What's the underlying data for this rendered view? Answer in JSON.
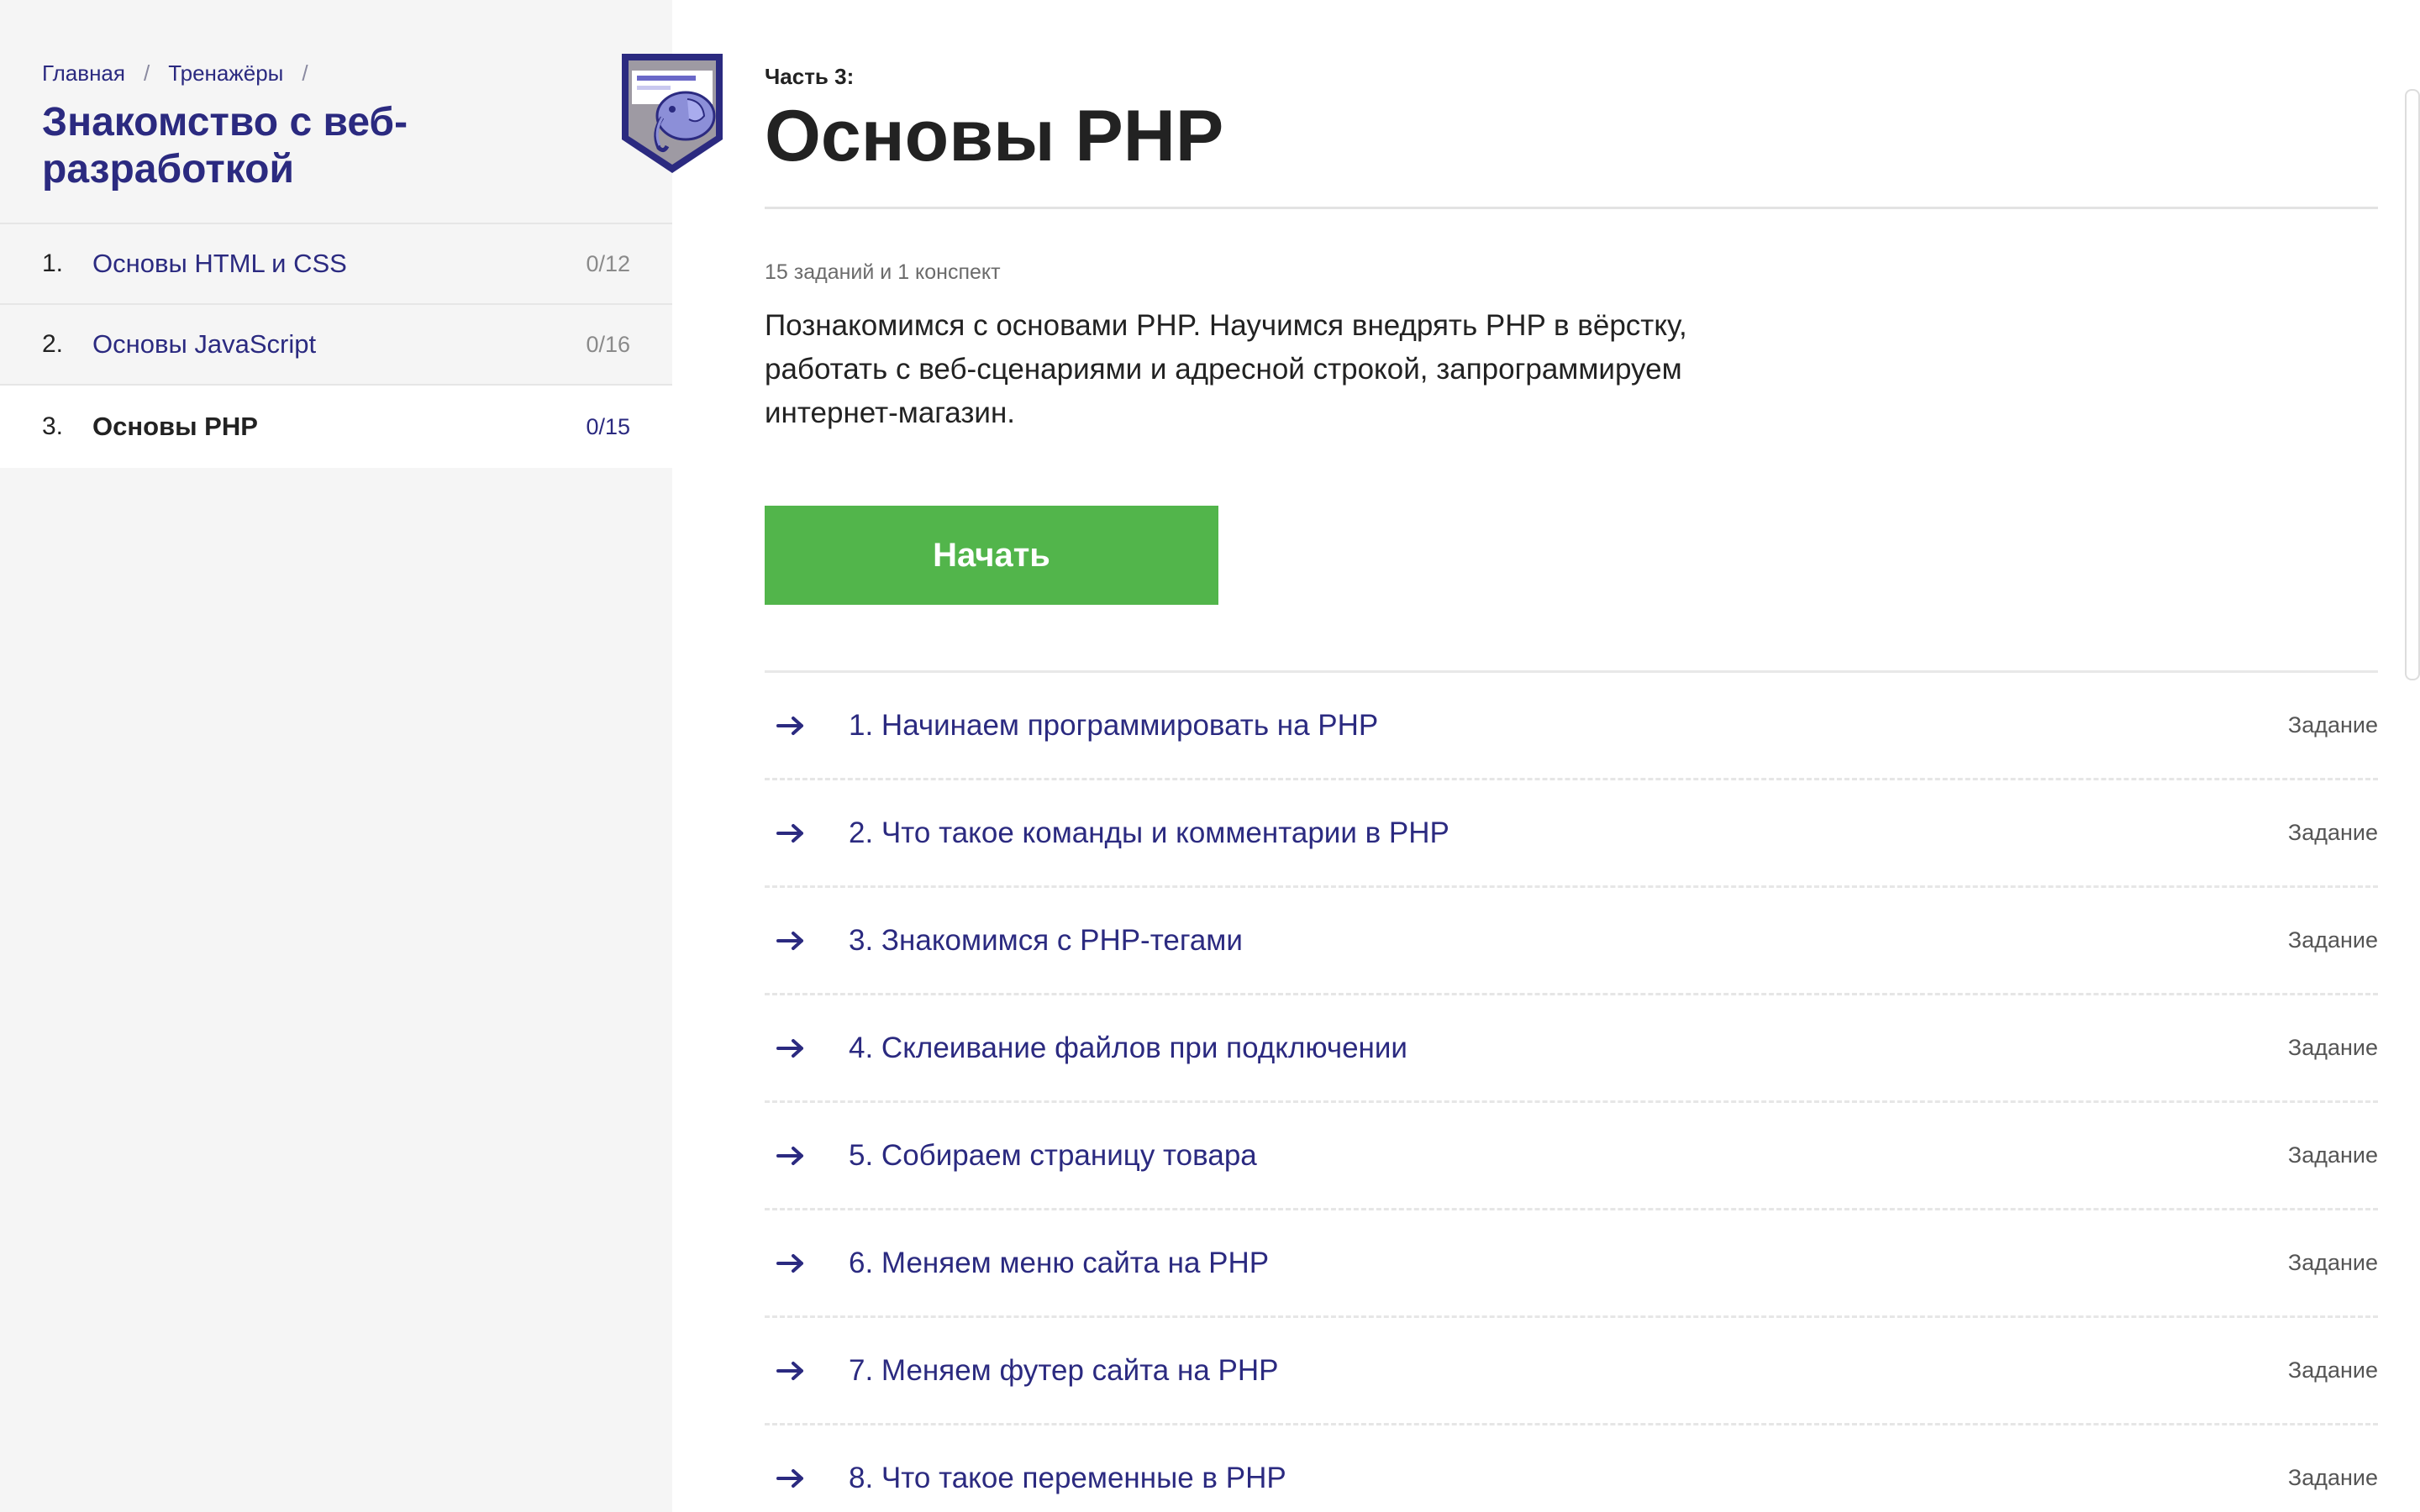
{
  "breadcrumb": {
    "items": [
      "Главная",
      "Тренажёры"
    ],
    "separator": "/"
  },
  "course": {
    "title": "Знакомство с веб-разработкой",
    "badge_icon": "php-elephant-shield-icon"
  },
  "parts": [
    {
      "num": "1.",
      "label": "Основы HTML и CSS",
      "count": "0/12",
      "active": false
    },
    {
      "num": "2.",
      "label": "Основы JavaScript",
      "count": "0/16",
      "active": false
    },
    {
      "num": "3.",
      "label": "Основы PHP",
      "count": "0/15",
      "active": true
    }
  ],
  "main": {
    "part_label": "Часть 3:",
    "title": "Основы PHP",
    "meta": "15 заданий и 1 конспект",
    "description": "Познакомимся с основами PHP. Научимся внедрять PHP в вёрстку, работать с веб-сценариями и адресной строкой, запрограммируем интернет-магазин.",
    "start_button": "Начать"
  },
  "tasks": [
    {
      "label": "1. Начинаем программировать на PHP",
      "type": "Задание"
    },
    {
      "label": "2. Что такое команды и комментарии в PHP",
      "type": "Задание"
    },
    {
      "label": "3. Знакомимся с PHP-тегами",
      "type": "Задание"
    },
    {
      "label": "4. Склеивание файлов при подключении",
      "type": "Задание"
    },
    {
      "label": "5. Собираем страницу товара",
      "type": "Задание"
    },
    {
      "label": "6. Меняем меню сайта на PHP",
      "type": "Задание"
    },
    {
      "label": "7. Меняем футер сайта на PHP",
      "type": "Задание"
    },
    {
      "label": "8. Что такое переменные в PHP",
      "type": "Задание"
    }
  ],
  "colors": {
    "accent": "#2b2a80",
    "button": "#52b54b",
    "sidebar_bg": "#f5f5f5"
  }
}
